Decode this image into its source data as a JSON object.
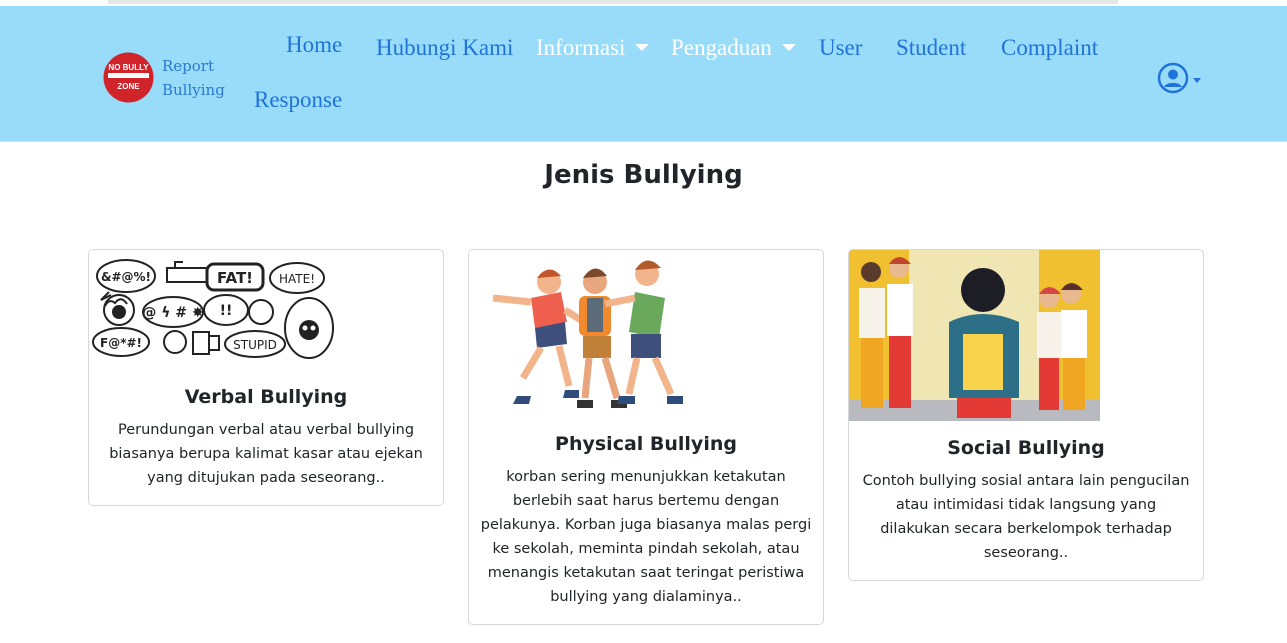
{
  "brand": {
    "logo_top": "NO BULLY",
    "logo_bottom": "ZONE",
    "line1": "Report",
    "line2": "Bullying"
  },
  "nav": {
    "home": "Home",
    "contact": "Hubungi Kami",
    "info": "Informasi",
    "complaint_menu": "Pengaduan",
    "user": "User",
    "student": "Student",
    "complaint": "Complaint",
    "response": "Response"
  },
  "page": {
    "title": "Jenis Bullying"
  },
  "cards": [
    {
      "title": "Verbal Bullying",
      "text": "Perundungan verbal atau verbal bullying biasanya berupa kalimat kasar atau ejekan yang ditujukan pada seseorang..",
      "image_words": [
        "&#@%!",
        "FAT!",
        "HATE!",
        "F@*#!",
        "STUPID"
      ]
    },
    {
      "title": "Physical Bullying",
      "text": "korban sering menunjukkan ketakutan berlebih saat harus bertemu dengan pelakunya. Korban juga biasanya malas pergi ke sekolah, meminta pindah sekolah, atau menangis ketakutan saat teringat peristiwa bullying yang dialaminya.."
    },
    {
      "title": "Social Bullying",
      "text": "Contoh bullying sosial antara lain pengucilan atau intimidasi tidak langsung yang dilakukan secara berkelompok terhadap seseorang.."
    }
  ],
  "colors": {
    "navbar": "#98dcfa",
    "link": "#1f73d9",
    "logo_red": "#d0232a"
  }
}
